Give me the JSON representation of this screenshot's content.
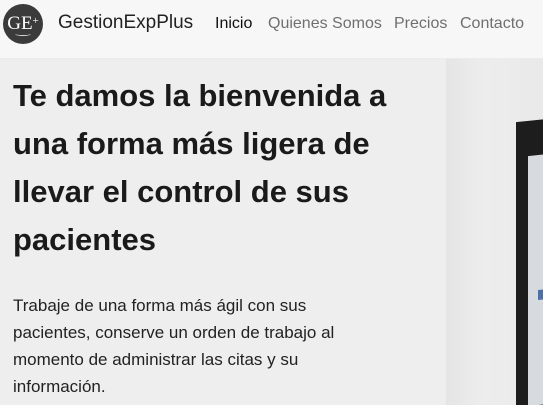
{
  "navbar": {
    "logo_text": "GE",
    "logo_sup": "+",
    "brand": "GestionExpPlus",
    "links": [
      {
        "label": "Inicio",
        "active": true
      },
      {
        "label": "Quienes Somos",
        "active": false
      },
      {
        "label": "Precios",
        "active": false
      },
      {
        "label": "Contacto",
        "active": false
      }
    ]
  },
  "hero": {
    "title": "Te damos la bienvenida a una forma más ligera de llevar el control de sus pacientes",
    "text": "Trabaje de una forma más ágil con sus pacientes, conserve un orden de trabajo al momento de administrar las citas y su información."
  }
}
